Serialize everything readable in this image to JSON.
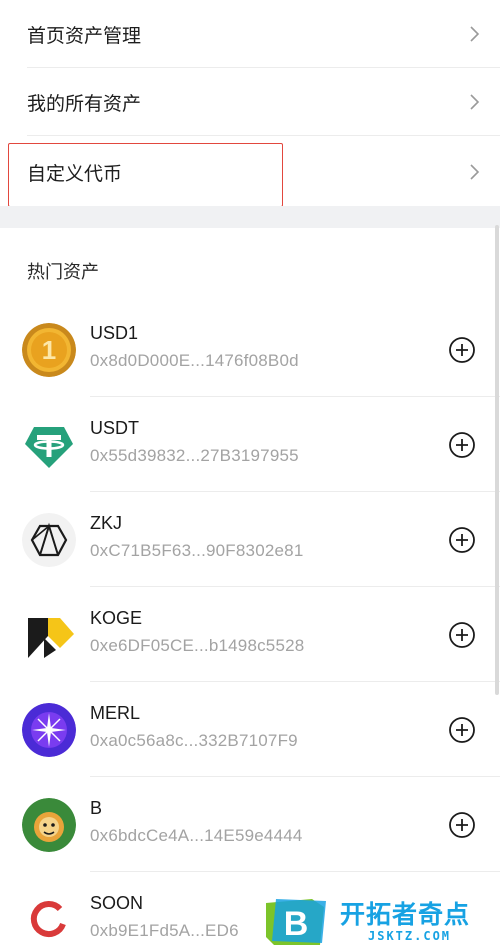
{
  "menu": {
    "items": [
      {
        "label": "首页资产管理"
      },
      {
        "label": "我的所有资产"
      },
      {
        "label": "自定义代币"
      }
    ]
  },
  "hot_assets": {
    "title": "热门资产",
    "items": [
      {
        "symbol": "USD1",
        "address": "0x8d0D000E...1476f08B0d",
        "icon": "usd1-coin-icon"
      },
      {
        "symbol": "USDT",
        "address": "0x55d39832...27B3197955",
        "icon": "tether-icon"
      },
      {
        "symbol": "ZKJ",
        "address": "0xC71B5F63...90F8302e81",
        "icon": "zkj-icon"
      },
      {
        "symbol": "KOGE",
        "address": "0xe6DF05CE...b1498c5528",
        "icon": "koge-icon"
      },
      {
        "symbol": "MERL",
        "address": "0xa0c56a8c...332B7107F9",
        "icon": "merl-icon"
      },
      {
        "symbol": "B",
        "address": "0x6bdcCe4A...14E59e4444",
        "icon": "b-token-icon"
      },
      {
        "symbol": "SOON",
        "address": "0xb9E1Fd5A...ED6",
        "icon": "soon-icon"
      }
    ]
  },
  "watermark": {
    "title": "开拓者奇点",
    "subtitle": "JSKTZ.COM",
    "badge_letter": "B"
  },
  "colors": {
    "highlight": "#e2473e",
    "secondary_text": "#a3a3a3",
    "section_band": "#f0f1f3",
    "watermark_blue": "#17a2e3"
  }
}
